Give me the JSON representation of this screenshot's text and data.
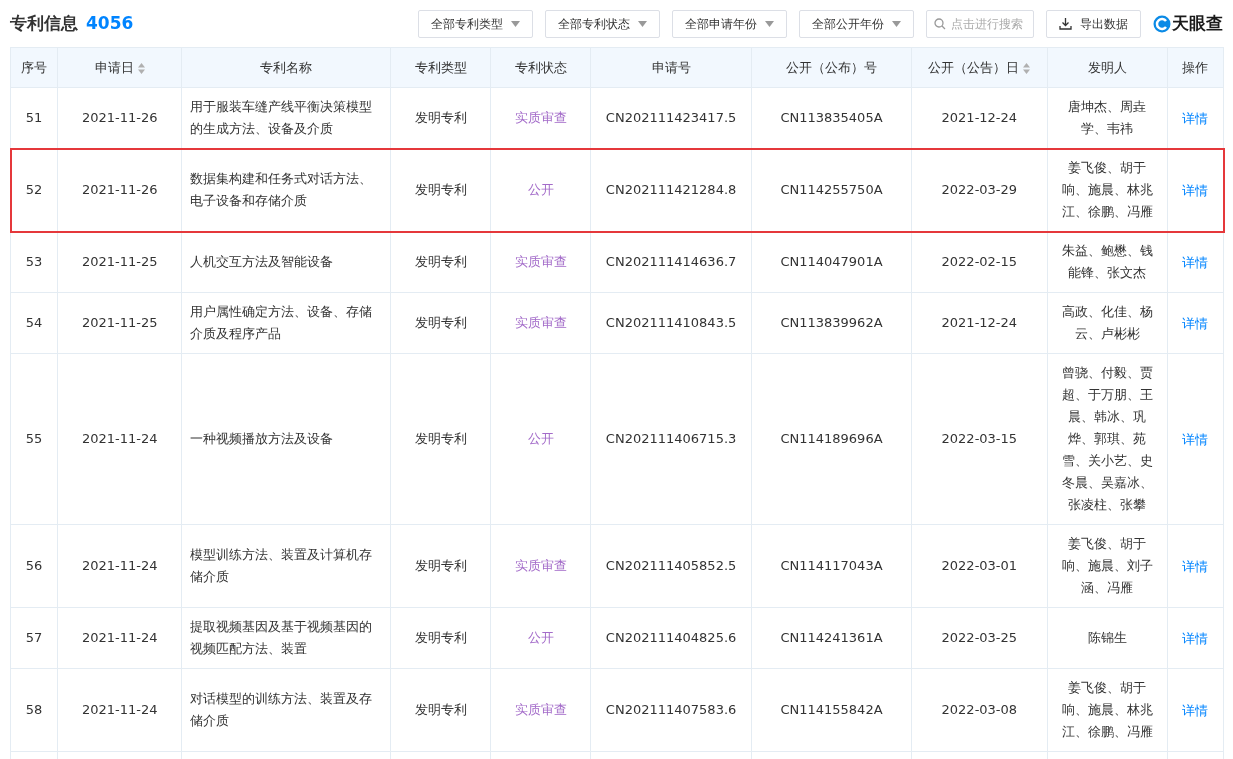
{
  "header": {
    "title": "专利信息",
    "count": "4056",
    "filters": [
      "全部专利类型",
      "全部专利状态",
      "全部申请年份",
      "全部公开年份"
    ],
    "search": {
      "placeholder": "点击进行搜索"
    },
    "export_button": "导出数据",
    "logo": "天眼查"
  },
  "table": {
    "columns": [
      {
        "label": "序号",
        "sortable": false
      },
      {
        "label": "申请日",
        "sortable": true
      },
      {
        "label": "专利名称",
        "sortable": false
      },
      {
        "label": "专利类型",
        "sortable": false
      },
      {
        "label": "专利状态",
        "sortable": false
      },
      {
        "label": "申请号",
        "sortable": false
      },
      {
        "label": "公开（公布）号",
        "sortable": false
      },
      {
        "label": "公开（公告）日",
        "sortable": true
      },
      {
        "label": "发明人",
        "sortable": false
      },
      {
        "label": "操作",
        "sortable": false
      }
    ],
    "rows": [
      {
        "no": "51",
        "date": "2021-11-26",
        "name": "用于服装车缝产线平衡决策模型的生成方法、设备及介质",
        "type": "发明专利",
        "status": "实质审查",
        "app_no": "CN202111423417.5",
        "pub_no": "CN113835405A",
        "pub_date": "2021-12-24",
        "inventors": "唐坤杰、周垚学、韦祎",
        "action": "详情",
        "highlighted": false
      },
      {
        "no": "52",
        "date": "2021-11-26",
        "name": "数据集构建和任务式对话方法、电子设备和存储介质",
        "type": "发明专利",
        "status": "公开",
        "app_no": "CN202111421284.8",
        "pub_no": "CN114255750A",
        "pub_date": "2022-03-29",
        "inventors": "姜飞俊、胡于响、施晨、林兆江、徐鹏、冯雁",
        "action": "详情",
        "highlighted": true
      },
      {
        "no": "53",
        "date": "2021-11-25",
        "name": "人机交互方法及智能设备",
        "type": "发明专利",
        "status": "实质审查",
        "app_no": "CN202111414636.7",
        "pub_no": "CN114047901A",
        "pub_date": "2022-02-15",
        "inventors": "朱益、鲍懋、钱能锋、张文杰",
        "action": "详情",
        "highlighted": false
      },
      {
        "no": "54",
        "date": "2021-11-25",
        "name": "用户属性确定方法、设备、存储介质及程序产品",
        "type": "发明专利",
        "status": "实质审查",
        "app_no": "CN202111410843.5",
        "pub_no": "CN113839962A",
        "pub_date": "2021-12-24",
        "inventors": "高政、化佳、杨云、卢彬彬",
        "action": "详情",
        "highlighted": false
      },
      {
        "no": "55",
        "date": "2021-11-24",
        "name": "一种视频播放方法及设备",
        "type": "发明专利",
        "status": "公开",
        "app_no": "CN202111406715.3",
        "pub_no": "CN114189696A",
        "pub_date": "2022-03-15",
        "inventors": "曾骁、付毅、贾超、于万朋、王晨、韩冰、巩烨、郭琪、苑雪、关小艺、史冬晨、吴嘉冰、张凌柱、张攀",
        "action": "详情",
        "highlighted": false
      },
      {
        "no": "56",
        "date": "2021-11-24",
        "name": "模型训练方法、装置及计算机存储介质",
        "type": "发明专利",
        "status": "实质审查",
        "app_no": "CN202111405852.5",
        "pub_no": "CN114117043A",
        "pub_date": "2022-03-01",
        "inventors": "姜飞俊、胡于响、施晨、刘子涵、冯雁",
        "action": "详情",
        "highlighted": false
      },
      {
        "no": "57",
        "date": "2021-11-24",
        "name": "提取视频基因及基于视频基因的视频匹配方法、装置",
        "type": "发明专利",
        "status": "公开",
        "app_no": "CN202111404825.6",
        "pub_no": "CN114241361A",
        "pub_date": "2022-03-25",
        "inventors": "陈锦生",
        "action": "详情",
        "highlighted": false
      },
      {
        "no": "58",
        "date": "2021-11-24",
        "name": "对话模型的训练方法、装置及存储介质",
        "type": "发明专利",
        "status": "实质审查",
        "app_no": "CN202111407583.6",
        "pub_no": "CN114155842A",
        "pub_date": "2022-03-08",
        "inventors": "姜飞俊、胡于响、施晨、林兆江、徐鹏、冯雁",
        "action": "详情",
        "highlighted": false
      }
    ]
  }
}
